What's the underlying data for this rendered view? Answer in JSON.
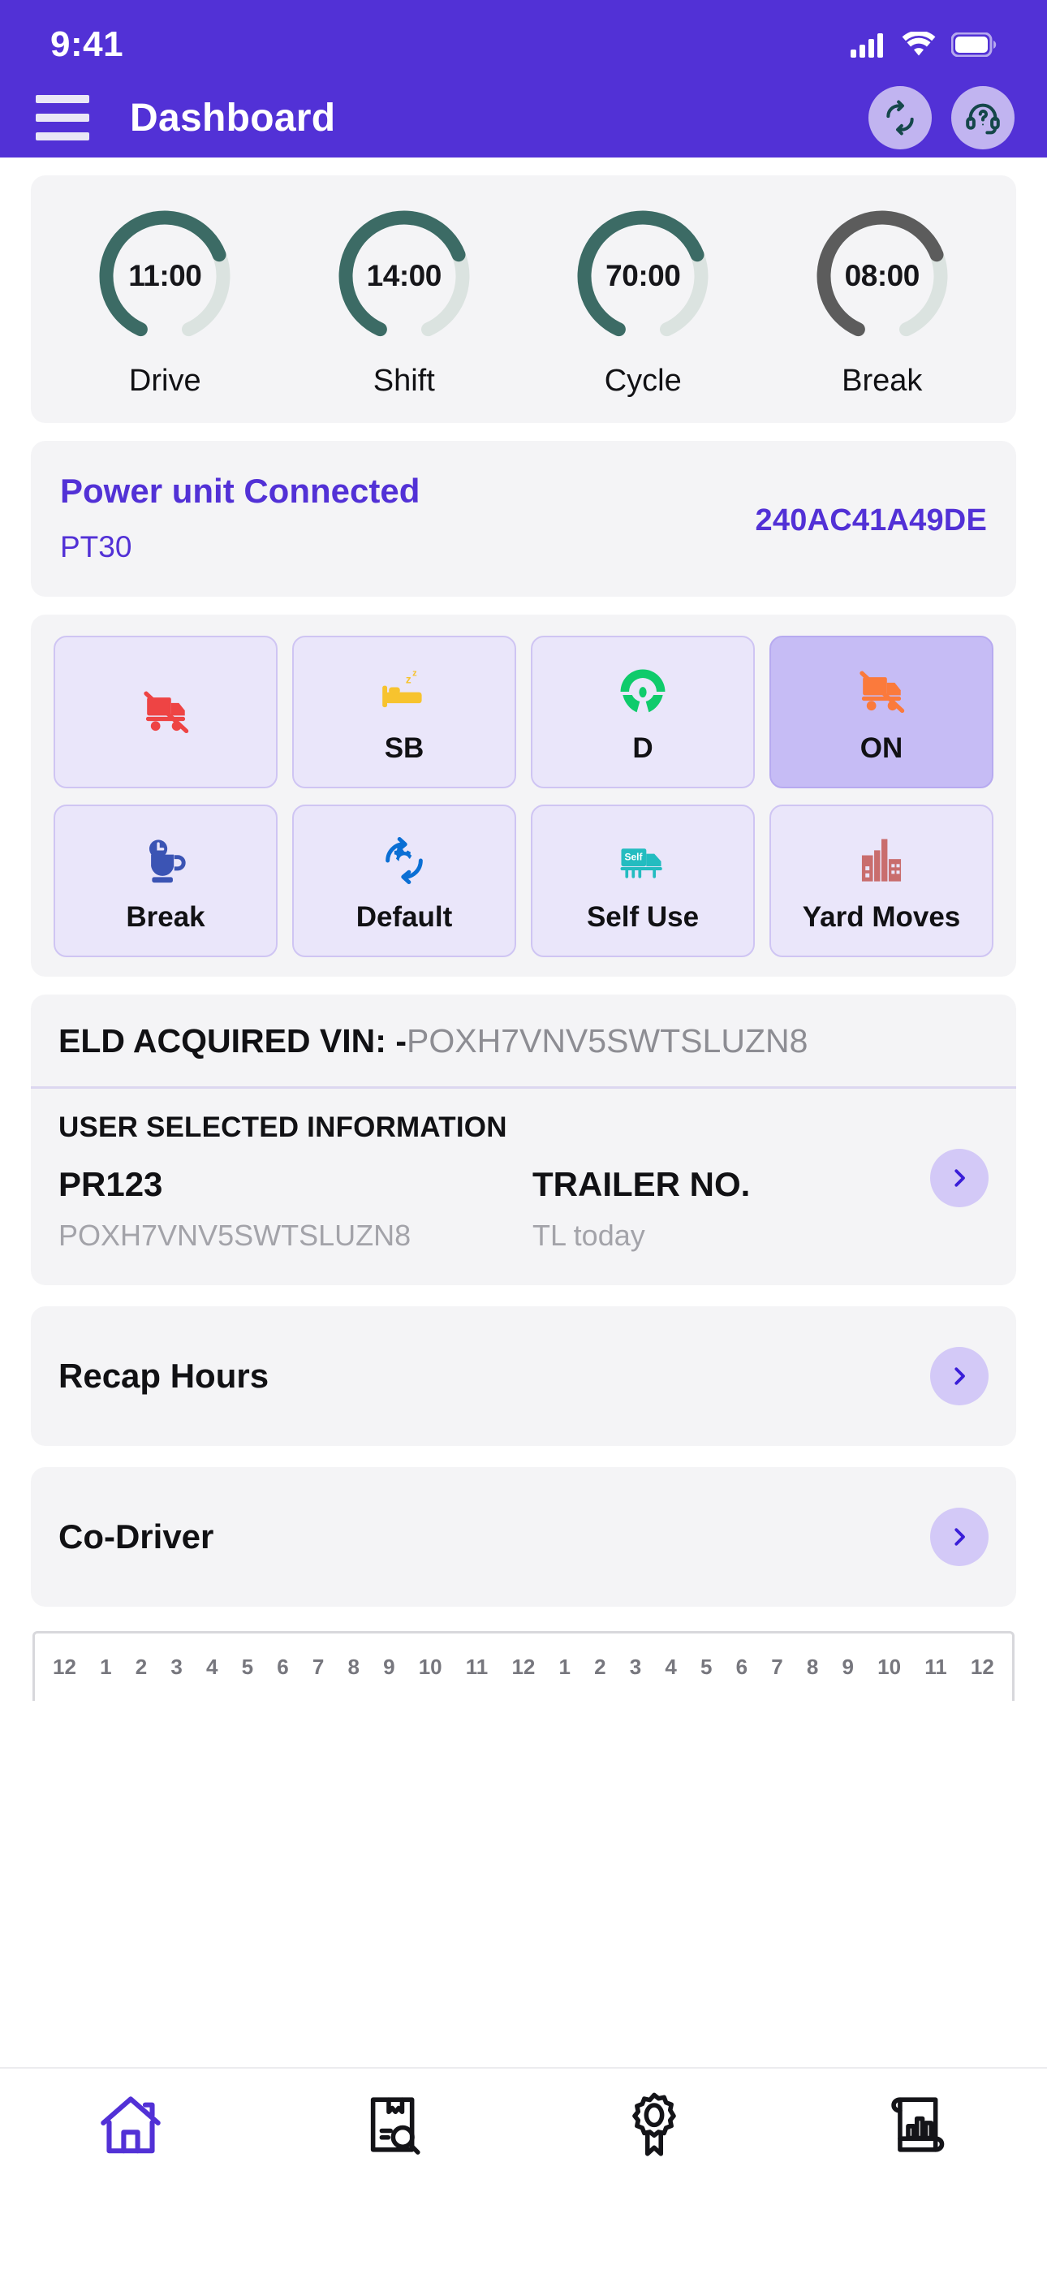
{
  "status_bar": {
    "time": "9:41",
    "icons": [
      "cellular-signal-icon",
      "wifi-icon",
      "battery-icon"
    ]
  },
  "app_bar": {
    "title": "Dashboard",
    "menu_icon": "hamburger-menu-icon",
    "actions": [
      {
        "name": "refresh-button",
        "icon": "refresh-sync-icon"
      },
      {
        "name": "support-button",
        "icon": "headset-help-icon"
      }
    ]
  },
  "gauges": [
    {
      "value": "11:00",
      "label": "Drive",
      "percent": 72,
      "color": "#3C6B65"
    },
    {
      "value": "14:00",
      "label": "Shift",
      "percent": 72,
      "color": "#3C6B65"
    },
    {
      "value": "70:00",
      "label": "Cycle",
      "percent": 72,
      "color": "#3C6B65"
    },
    {
      "value": "08:00",
      "label": "Break",
      "percent": 72,
      "color": "#5C5C5C"
    }
  ],
  "gauge_track_color": "#DBE3E0",
  "power_unit": {
    "title": "Power unit Connected",
    "unit": "PT30",
    "device_id": "240AC41A49DE",
    "accent": "#5231D6"
  },
  "duty_status": {
    "row1": [
      {
        "label": "",
        "icon": "red-truck-off-duty-icon",
        "color": "#EE4444",
        "selected": false,
        "name": "duty-off"
      },
      {
        "label": "SB",
        "icon": "yellow-sleeper-bed-icon",
        "color": "#F7C32E",
        "selected": false,
        "name": "duty-sb"
      },
      {
        "label": "D",
        "icon": "green-steering-wheel-icon",
        "color": "#0FCB6B",
        "selected": false,
        "name": "duty-drive"
      },
      {
        "label": "ON",
        "icon": "orange-truck-on-duty-icon",
        "color": "#FB7A3C",
        "selected": true,
        "name": "duty-on"
      }
    ],
    "row2": [
      {
        "label": "Break",
        "icon": "blue-coffee-clock-icon",
        "color": "#3B54B4",
        "selected": false,
        "name": "duty-break"
      },
      {
        "label": "Default",
        "icon": "blue-gear-refresh-icon",
        "color": "#0B6FD4",
        "selected": false,
        "name": "duty-default"
      },
      {
        "label": "Self Use",
        "icon": "teal-self-use-truck-icon",
        "color": "#23BCC0",
        "selected": false,
        "name": "duty-self-use"
      },
      {
        "label": "Yard Moves",
        "icon": "red-factory-yard-icon",
        "color": "#C96D6D",
        "selected": false,
        "name": "duty-yard-moves"
      }
    ]
  },
  "vin": {
    "label": "ELD ACQUIRED VIN: -",
    "value": "POXH7VNV5SWTSLUZN8"
  },
  "user_selected_information": {
    "title": "USER SELECTED INFORMATION",
    "left_main": "PR123",
    "left_sub": "POXH7VNV5SWTSLUZN8",
    "right_main": "TRAILER NO.",
    "right_sub": "TL today",
    "chevron_icon": "chevron-right-icon"
  },
  "nav_rows": [
    {
      "label": "Recap Hours",
      "name": "recap-hours-row",
      "chevron_icon": "chevron-right-icon"
    },
    {
      "label": "Co-Driver",
      "name": "co-driver-row",
      "chevron_icon": "chevron-right-icon"
    }
  ],
  "time_ruler": {
    "ticks": [
      "12",
      "1",
      "2",
      "3",
      "4",
      "5",
      "6",
      "7",
      "8",
      "9",
      "10",
      "11",
      "12",
      "1",
      "2",
      "3",
      "4",
      "5",
      "6",
      "7",
      "8",
      "9",
      "10",
      "11",
      "12"
    ]
  },
  "bottom_nav": [
    {
      "name": "nav-home",
      "icon": "home-icon",
      "active": true,
      "color": "#5231D6"
    },
    {
      "name": "nav-inspection",
      "icon": "document-search-icon",
      "active": false,
      "color": "#141418"
    },
    {
      "name": "nav-certify",
      "icon": "award-ribbon-icon",
      "active": false,
      "color": "#141418"
    },
    {
      "name": "nav-reports",
      "icon": "report-scroll-icon",
      "active": false,
      "color": "#141418"
    }
  ],
  "theme": {
    "header_purple": "#5231D6",
    "card_gray": "#F4F4F6",
    "chip_lavender": "#EAE6FA",
    "chip_selected": "#C6BCF5"
  }
}
